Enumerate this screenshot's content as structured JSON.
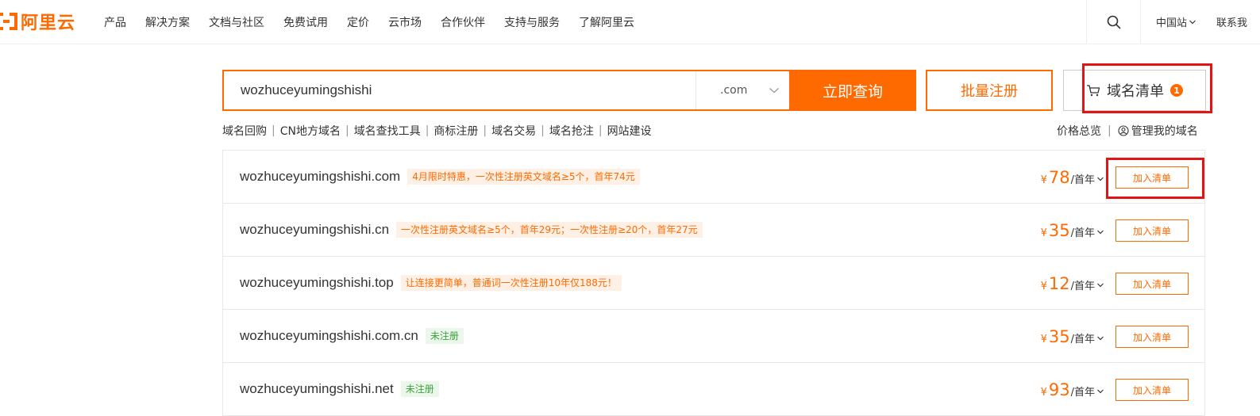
{
  "brand": {
    "name": "阿里云",
    "color": "#ff6a00"
  },
  "nav": {
    "items": [
      "产品",
      "解决方案",
      "文档与社区",
      "免费试用",
      "定价",
      "云市场",
      "合作伙伴",
      "支持与服务",
      "了解阿里云"
    ],
    "region": "中国站",
    "contact": "联系我"
  },
  "search": {
    "value": "wozhuceyumingshishi",
    "suffix": ".com",
    "query_label": "立即查询",
    "batch_label": "批量注册",
    "cart_label": "域名清单",
    "cart_count": "1"
  },
  "links": [
    "域名回购",
    "CN地方域名",
    "域名查找工具",
    "商标注册",
    "域名交易",
    "域名抢注",
    "网站建设"
  ],
  "right_links": {
    "price_overview": "价格总览",
    "manage": "管理我的域名"
  },
  "results": [
    {
      "domain": "wozhuceyumingshishi.com",
      "tag": "4月限时特惠，一次性注册英文域名≥5个，首年74元",
      "tag_type": "promo",
      "currency": "¥",
      "price": "78",
      "unit": "/首年",
      "action": "加入清单"
    },
    {
      "domain": "wozhuceyumingshishi.cn",
      "tag": "一次性注册英文域名≥5个，首年29元；一次性注册≥20个，首年27元",
      "tag_type": "promo",
      "currency": "¥",
      "price": "35",
      "unit": "/首年",
      "action": "加入清单"
    },
    {
      "domain": "wozhuceyumingshishi.top",
      "tag": "让连接更简单，普通词一次性注册10年仅188元！",
      "tag_type": "promo",
      "currency": "¥",
      "price": "12",
      "unit": "/首年",
      "action": "加入清单"
    },
    {
      "domain": "wozhuceyumingshishi.com.cn",
      "tag": "未注册",
      "tag_type": "status",
      "currency": "¥",
      "price": "35",
      "unit": "/首年",
      "action": "加入清单"
    },
    {
      "domain": "wozhuceyumingshishi.net",
      "tag": "未注册",
      "tag_type": "status",
      "currency": "¥",
      "price": "93",
      "unit": "/首年",
      "action": "加入清单"
    }
  ]
}
